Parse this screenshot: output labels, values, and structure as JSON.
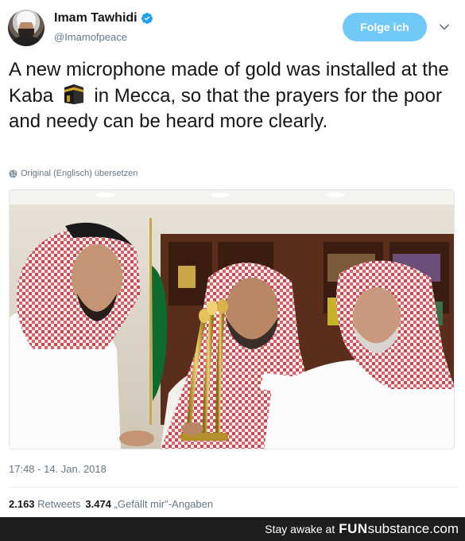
{
  "tweet": {
    "author": {
      "display_name": "Imam Tawhidi",
      "handle": "@Imamofpeace",
      "verified": true,
      "avatar_icon": "avatar-photo"
    },
    "follow_label": "Folge ich",
    "text_before_icon": "A new microphone made of gold was installed at the Kaba",
    "inline_icon": "kaaba-icon",
    "text_after_icon": "in Mecca, so that the prayers for the poor and needy can be heard more clearly.",
    "translate_label": "Original (Englisch) übersetzen",
    "timestamp": "17:48 - 14. Jan. 2018",
    "stats": {
      "retweets_count": "2.163",
      "retweets_label": "Retweets",
      "likes_count": "3.474",
      "likes_label": "„Gefällt mir\"-Angaben"
    }
  },
  "footer": {
    "prefix": "Stay awake at",
    "brand_fun": "FUN",
    "brand_substance": "substance.com"
  },
  "colors": {
    "accent": "#1da1f2",
    "follow_button": "#71c9f8",
    "secondary_text": "#657786",
    "footer_bg": "#1e1e1e"
  }
}
